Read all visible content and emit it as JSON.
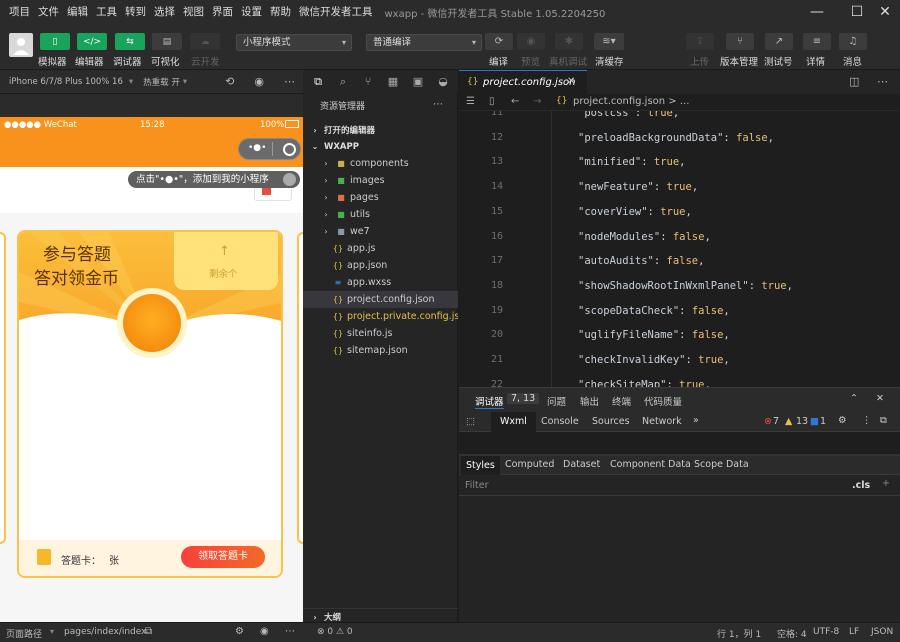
{
  "menubar": {
    "items": [
      "项目",
      "文件",
      "编辑",
      "工具",
      "转到",
      "选择",
      "视图",
      "界面",
      "设置",
      "帮助",
      "微信开发者工具"
    ],
    "title": "wxapp - 微信开发者工具 Stable 1.05.2204250",
    "window_controls": {
      "minimize": "—",
      "maximize": "☐",
      "close": "✕"
    }
  },
  "toolbar": {
    "buttons": [
      {
        "label": "模拟器",
        "icon": "phone-icon"
      },
      {
        "label": "编辑器",
        "icon": "code-icon"
      },
      {
        "label": "调试器",
        "icon": "debug-icon"
      },
      {
        "label": "可视化",
        "icon": "layout-icon"
      },
      {
        "label": "云开发",
        "icon": "cloud-icon"
      }
    ],
    "mode_select": "小程序模式",
    "compile_select": "普通编译",
    "actions": [
      {
        "label": "编译",
        "enabled": true
      },
      {
        "label": "预览",
        "enabled": false
      },
      {
        "label": "真机调试",
        "enabled": false
      },
      {
        "label": "清缓存",
        "enabled": true
      }
    ],
    "right_actions": [
      {
        "label": "上传",
        "enabled": false
      },
      {
        "label": "版本管理",
        "enabled": true
      },
      {
        "label": "测试号",
        "enabled": true
      },
      {
        "label": "详情",
        "enabled": true
      },
      {
        "label": "消息",
        "enabled": true
      }
    ]
  },
  "simulator": {
    "device": "iPhone 6/7/8 Plus 100% 16",
    "hotreload": "热重载 开",
    "statusbar": {
      "carrier": "●●●●● WeChat",
      "time": "15:28",
      "battery": "100%"
    },
    "tooltip": "点击\"•●•\"，添加到我的小程序",
    "card": {
      "title_line1": "参与答题",
      "title_line2": "答对领金币",
      "remaining_arrow": "↑",
      "remaining_label": "剩余个",
      "answer_card_label": "答题卡：",
      "answer_card_unit": "张",
      "claim_button": "领取答题卡"
    },
    "footer": {
      "path_label": "页面路径",
      "path": "pages/index/index"
    }
  },
  "explorer": {
    "header": "资源管理器",
    "open_editors": "打开的编辑器",
    "root": "WXAPP",
    "items": [
      {
        "name": "components",
        "type": "folder"
      },
      {
        "name": "images",
        "type": "folder"
      },
      {
        "name": "pages",
        "type": "folder"
      },
      {
        "name": "utils",
        "type": "folder"
      },
      {
        "name": "we7",
        "type": "folder"
      },
      {
        "name": "app.js",
        "type": "js"
      },
      {
        "name": "app.json",
        "type": "json"
      },
      {
        "name": "app.wxss",
        "type": "wxss"
      },
      {
        "name": "project.config.json",
        "type": "json",
        "active": true
      },
      {
        "name": "project.private.config.js...",
        "type": "json"
      },
      {
        "name": "siteinfo.js",
        "type": "js"
      },
      {
        "name": "sitemap.json",
        "type": "json"
      }
    ],
    "outline": "大纲",
    "problems": "⊗ 0 ⚠ 0"
  },
  "editor": {
    "tab": "project.config.json",
    "breadcrumb": "project.config.json > ...",
    "lines": [
      {
        "n": "11",
        "key": "\"postcss\"",
        "val": "true"
      },
      {
        "n": "12",
        "key": "\"preloadBackgroundData\"",
        "val": "false"
      },
      {
        "n": "13",
        "key": "\"minified\"",
        "val": "true"
      },
      {
        "n": "14",
        "key": "\"newFeature\"",
        "val": "true"
      },
      {
        "n": "15",
        "key": "\"coverView\"",
        "val": "true"
      },
      {
        "n": "16",
        "key": "\"nodeModules\"",
        "val": "false"
      },
      {
        "n": "17",
        "key": "\"autoAudits\"",
        "val": "false"
      },
      {
        "n": "18",
        "key": "\"showShadowRootInWxmlPanel\"",
        "val": "true"
      },
      {
        "n": "19",
        "key": "\"scopeDataCheck\"",
        "val": "false"
      },
      {
        "n": "20",
        "key": "\"uglifyFileName\"",
        "val": "false"
      },
      {
        "n": "21",
        "key": "\"checkInvalidKey\"",
        "val": "true"
      },
      {
        "n": "22",
        "key": "\"checkSiteMap\"",
        "val": "true"
      }
    ]
  },
  "devtools": {
    "tabs": [
      {
        "label": "调试器",
        "badge": "7, 13",
        "active": true
      },
      {
        "label": "问题"
      },
      {
        "label": "输出"
      },
      {
        "label": "终端"
      },
      {
        "label": "代码质量"
      }
    ],
    "panels": [
      "Wxml",
      "Console",
      "Sources",
      "Network"
    ],
    "more": "»",
    "counts": {
      "errors": "7",
      "warnings": "13",
      "info": "1"
    },
    "subtabs": [
      "Styles",
      "Computed",
      "Dataset",
      "Component Data",
      "Scope Data"
    ],
    "filter_placeholder": "Filter",
    "cls": ".cls"
  },
  "statusline": {
    "position": "行 1，列 1",
    "spaces": "空格: 4",
    "encoding": "UTF-8",
    "eol": "LF",
    "language": "JSON"
  },
  "colors": {
    "accent_green": "#19a35c",
    "brand_orange": "#f8921c",
    "active_tab_border": "#2d78d1",
    "json_key": "#c9d1d9",
    "json_value": "#e6c07b"
  }
}
